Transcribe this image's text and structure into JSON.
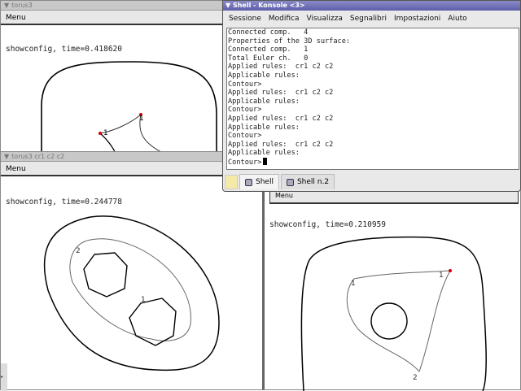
{
  "windows": {
    "top_left": {
      "title": "torus3",
      "menu": "Menu",
      "info": "showconfig, time=0.418620",
      "labels": [
        "1",
        "1"
      ]
    },
    "bottom_left": {
      "title": "torus3  cr1 c2 c2",
      "menu": "Menu",
      "info": "showconfig, time=0.244778",
      "labels": [
        "2",
        "1"
      ]
    },
    "bottom_right": {
      "menu": "Menu",
      "info": "showconfig, time=0.210959",
      "labels": [
        "1",
        "1",
        "2"
      ]
    }
  },
  "konsole": {
    "title": "Shell - Konsole <3>",
    "menu": [
      "Sessione",
      "Modifica",
      "Visualizza",
      "Segnalibri",
      "Impostazioni",
      "Aiuto"
    ],
    "lines": [
      "Connected comp.   4",
      "Properties of the 3D surface:",
      "Connected comp.   1",
      "Total Euler ch.   0",
      "Applied rules:  cr1 c2 c2",
      "Applicable rules:",
      "Contour>",
      "Applied rules:  cr1 c2 c2",
      "Applicable rules:",
      "Contour>",
      "Applied rules:  cr1 c2 c2",
      "Applicable rules:",
      "Contour>",
      "Applied rules:  cr1 c2 c2",
      "Applicable rules:"
    ],
    "prompt": "Contour>",
    "tabs": [
      "Shell",
      "Shell n.2"
    ]
  }
}
